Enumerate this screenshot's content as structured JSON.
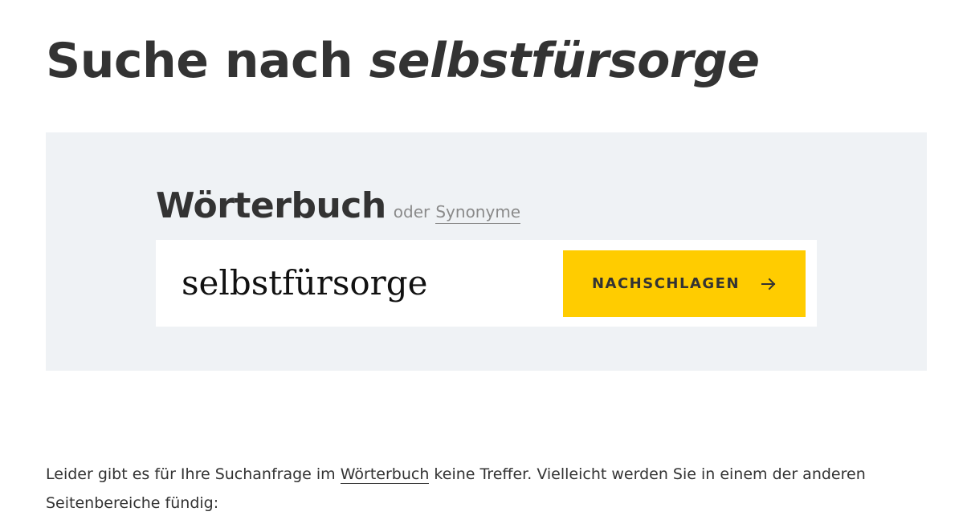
{
  "title": {
    "prefix": "Suche nach ",
    "query": "selbstfürsorge"
  },
  "search": {
    "heading": "Wörterbuch",
    "or_text": "oder",
    "synonyms_link": "Synonyme",
    "input_value": "selbstfürsorge",
    "button_label": "NACHSCHLAGEN",
    "button_icon": "arrow-right-icon"
  },
  "message": {
    "part1": "Leider gibt es für Ihre Suchanfrage im ",
    "link": "Wörterbuch",
    "part2": " keine Treffer. Vielleicht werden Sie in einem der anderen Seitenbereiche fündig:"
  },
  "colors": {
    "accent": "#ffcc00",
    "panel_bg": "#eff2f5",
    "text": "#333333",
    "muted": "#8a8a8a"
  }
}
